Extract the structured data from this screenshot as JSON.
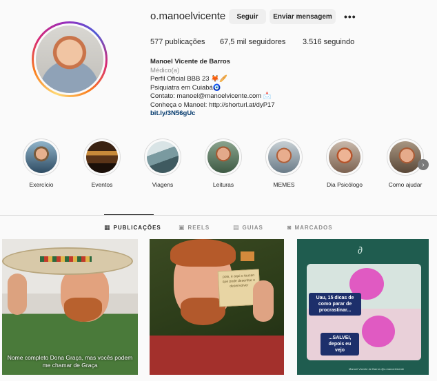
{
  "profile": {
    "username": "o.manoelvicente",
    "follow_label": "Seguir",
    "message_label": "Enviar mensagem",
    "more_label": "•••",
    "stats": {
      "posts": "577 publicações",
      "followers": "67,5 mil seguidores",
      "following": "3.516 seguindo"
    },
    "bio": {
      "name": "Manoel Vicente de Barros",
      "category": "Médico(a)",
      "lines": [
        "Perfil Oficial BBB 23 🦊🥖",
        "Psiquiatra em Cuiabá🧿",
        "Contato: manoel@manoelvicente.com 📩",
        "Conheça o Manoel: http://shorturl.at/dyP17"
      ],
      "link": "bit.ly/3N56gUc"
    }
  },
  "highlights": [
    {
      "label": "Exercício",
      "color": "#3b5a6e"
    },
    {
      "label": "Eventos",
      "color": "#6b3a1c"
    },
    {
      "label": "Viagens",
      "color": "#7da0a8"
    },
    {
      "label": "Leituras",
      "color": "#4e6b52"
    },
    {
      "label": "MEMES",
      "color": "#5a6d7a"
    },
    {
      "label": "Dia Psicólogo",
      "color": "#b26a4c"
    },
    {
      "label": "Como ajudar",
      "color": "#8a6b50"
    }
  ],
  "tabs": {
    "posts": "PUBLICAÇÕES",
    "reels": "REELS",
    "guides": "GUIAS",
    "tagged": "MARCADOS"
  },
  "posts": {
    "post1_caption": "Nome completo Dona Graça, mas vocês podem me chamar de Graça",
    "post2_card": "pois, é aqui o toucan que pode desenhar e desenvolver",
    "post3_top": "Uau, 15 dicas de como parar de procrastinar...",
    "post3_bottom": "...SALVEI, depois eu vejo",
    "post3_footer": "Manoel Vicente de Barros @o.manoelvicente"
  },
  "colors": {
    "accent_link": "#00376b",
    "button_bg": "#efefef"
  }
}
